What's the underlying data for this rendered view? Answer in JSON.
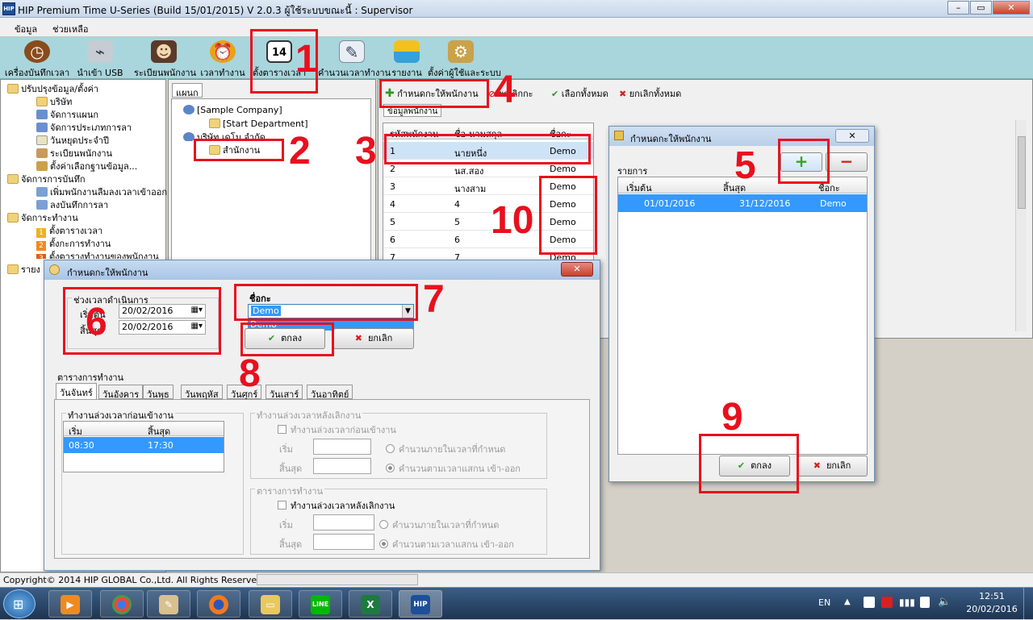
{
  "window": {
    "title": "HIP Premium Time U-Series (Build 15/01/2015) V 2.0.3    ผู้ใช้ระบบขณะนี้  : Supervisor",
    "min_label": "–",
    "max_label": "▭",
    "close_label": "✕"
  },
  "menu": [
    "ข้อมูล",
    "ช่วยเหลือ"
  ],
  "toolbar": [
    {
      "label": "เครื่องบันทึกเวลา",
      "icon": "clock-icon"
    },
    {
      "label": "นำเข้า USB",
      "icon": "usb-icon"
    },
    {
      "label": "ระเบียนพนักงาน",
      "icon": "people-icon"
    },
    {
      "label": "เวลาทำงาน",
      "icon": "alarm-clock-icon"
    },
    {
      "label": "ตั้งตารางเวลา",
      "icon": "calendar-icon",
      "icon_text": "14"
    },
    {
      "label": "คำนวนเวลาทำงาน",
      "icon": "document-icon"
    },
    {
      "label": "รายงาน",
      "icon": "report-icon"
    },
    {
      "label": "ตั้งค่าผู้ใช้และระบบ",
      "icon": "settings-icon"
    }
  ],
  "tree": {
    "groups": [
      {
        "label": "ปรับปรุงข้อมูล/ตั้งค่า",
        "items": [
          "บริษัท",
          "จัดการแผนก",
          "จัดการประเภทการลา",
          "วันหยุดประจำปี",
          "ระเบียนพนักงาน",
          "ตั้งค่าเลือกฐานข้อมูล..."
        ]
      },
      {
        "label": "จัดการการบันทึก",
        "items": [
          "เพิ่มพนักงานลืมลงเวลาเข้าออก",
          "ลงบันทึกการลา"
        ]
      },
      {
        "label": "จัดการะทำงาน",
        "items": [
          "ตั้งตารางเวลา",
          "ตั้งกะการทำงาน",
          "ตั้งตารางทำงานของพนักงาน"
        ]
      },
      {
        "label": "รายงาน",
        "items": []
      }
    ],
    "number_badges": [
      "1",
      "2",
      "3"
    ]
  },
  "dept_panel": {
    "tab": "แผนก",
    "nodes": [
      "[Sample Company]",
      "[Start Department]",
      "บริษัท เดโม จำกัด",
      "สำนักงาน"
    ]
  },
  "emp_panel": {
    "actions": [
      "กำหนดกะให้พนักงาน",
      "ยกเลิกกะ",
      "เลือกทั้งหมด",
      "ยกเลิกทั้งหมด"
    ],
    "tab": "ข้อมูลพนักงาน",
    "columns": [
      "รหัสพนักงาน",
      "ชื่อ-นามสกุล",
      "ชื่อกะ"
    ],
    "rows": [
      [
        "1",
        "นายหนึ่ง",
        "Demo"
      ],
      [
        "2",
        "นส.สอง",
        "Demo"
      ],
      [
        "3",
        "นางสาม",
        "Demo"
      ],
      [
        "4",
        "4",
        "Demo"
      ],
      [
        "5",
        "5",
        "Demo"
      ],
      [
        "6",
        "6",
        "Demo"
      ],
      [
        "7",
        "7",
        "Demo"
      ]
    ]
  },
  "assign_dialog": {
    "title": "กำหนดกะให้พนักงาน",
    "list_label": "รายการ",
    "add_label": "+",
    "remove_label": "−",
    "columns": [
      "เริ่มต้น",
      "สิ้นสุด",
      "ชื่อกะ"
    ],
    "rows": [
      [
        "01/01/2016",
        "31/12/2016",
        "Demo"
      ]
    ],
    "ok": "ตกลง",
    "cancel": "ยกเลิก"
  },
  "shift_dialog": {
    "title": "กำหนดกะให้พนักงาน",
    "period_group": "ช่วงเวลาดำเนินการ",
    "start_label": "เริ่มต้น",
    "end_label": "สิ้นสุด",
    "start_value": "20/02/2016",
    "end_value": "20/02/2016",
    "shift_label": "ชื่อกะ",
    "shift_value": "Demo",
    "shift_option": "Demo",
    "ok": "ตกลง",
    "cancel": "ยกเลิก",
    "schedule_label": "ตารางการทำงาน",
    "days": [
      "วันจันทร์",
      "วันอังคาร",
      "วันพุธ",
      "วันพฤหัส",
      "วันศุกร์",
      "วันเสาร์",
      "วันอาทิตย์"
    ],
    "before_group": "ทำงานล่วงเวลาก่อนเข้างาน",
    "before_cols": [
      "เริ่ม",
      "สิ้นสุด"
    ],
    "before_rows": [
      [
        "08:30",
        "17:30"
      ]
    ],
    "after_group": "ทำงานล่วงเวลาหลังเลิกงาน",
    "after_check": "ทำงานล่วงเวลาก่อนเข้างาน",
    "start_short": "เริ่ม",
    "end_short": "สิ้นสุด",
    "radio_within": "คำนวนภายในเวลาที่กำหนด",
    "radio_scan": "คำนวนตามเวลาแสกน เข้า-ออก",
    "work_group": "ตารางการทำงาน",
    "work_check": "ทำงานล่วงเวลาหลังเลิกงาน"
  },
  "annotations": [
    "1",
    "2",
    "3",
    "4",
    "5",
    "6",
    "7",
    "8",
    "9",
    "10"
  ],
  "status": "Copyright© 2014 HIP GLOBAL Co.,Ltd. All Rights Reserved",
  "taskbar": {
    "lang": "EN",
    "time": "12:51",
    "date": "20/02/2016",
    "apps": [
      "media-player",
      "chrome",
      "paint",
      "firefox",
      "file-explorer",
      "line",
      "excel",
      "hip-time"
    ]
  },
  "colors": {
    "annotation_red": "#e8101e",
    "selection_blue": "#3399ff",
    "toolbar_teal": "#a8d6dc"
  }
}
